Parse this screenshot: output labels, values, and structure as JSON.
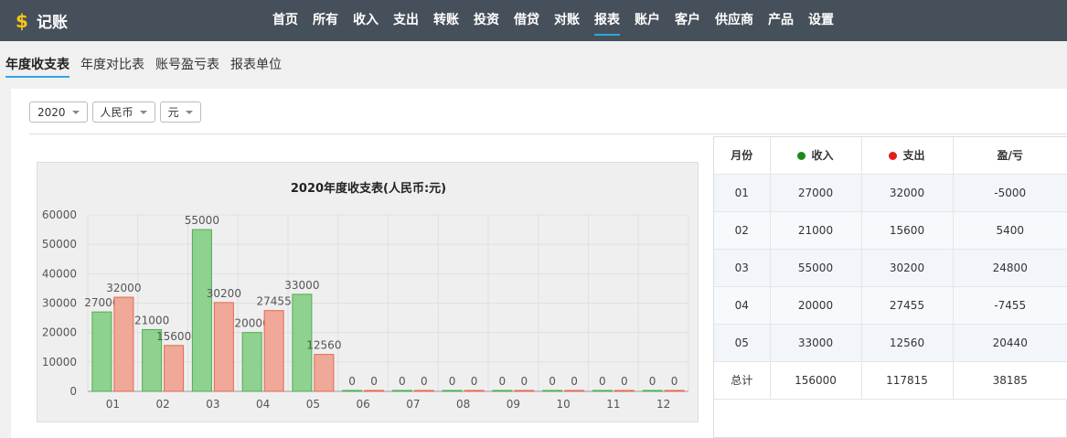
{
  "app": {
    "logo_symbol": "$",
    "title": "记账",
    "accent_color": "#2ea7e0",
    "logo_color": "#f5c518"
  },
  "nav": {
    "items": [
      "首页",
      "所有",
      "收入",
      "支出",
      "转账",
      "投资",
      "借贷",
      "对账",
      "报表",
      "账户",
      "客户",
      "供应商",
      "产品",
      "设置"
    ],
    "active": "报表"
  },
  "subtabs": {
    "items": [
      "年度收支表",
      "年度对比表",
      "账号盈亏表",
      "报表单位"
    ],
    "active": "年度收支表"
  },
  "filters": {
    "year": "2020",
    "currency": "人民币",
    "unit": "元"
  },
  "chart_data": {
    "type": "bar",
    "title": "2020年度收支表(人民币:元)",
    "categories": [
      "01",
      "02",
      "03",
      "04",
      "05",
      "06",
      "07",
      "08",
      "09",
      "10",
      "11",
      "12"
    ],
    "series": [
      {
        "name": "收入",
        "color": "#8fd18f",
        "stroke": "#4caf50",
        "values": [
          27000,
          21000,
          55000,
          20000,
          33000,
          0,
          0,
          0,
          0,
          0,
          0,
          0
        ]
      },
      {
        "name": "支出",
        "color": "#f0a898",
        "stroke": "#e06a50",
        "values": [
          32000,
          15600,
          30200,
          27455,
          12560,
          0,
          0,
          0,
          0,
          0,
          0,
          0
        ]
      }
    ],
    "ylim": [
      0,
      60000
    ],
    "yticks": [
      0,
      10000,
      20000,
      30000,
      40000,
      50000,
      60000
    ],
    "grid": true
  },
  "table": {
    "headers": {
      "month": "月份",
      "income": "收入",
      "expense": "支出",
      "profit": "盈/亏"
    },
    "income_color": "#1a8a1a",
    "expense_color": "#e51c1c",
    "rows": [
      [
        "01",
        "27000",
        "32000",
        "-5000"
      ],
      [
        "02",
        "21000",
        "15600",
        "5400"
      ],
      [
        "03",
        "55000",
        "30200",
        "24800"
      ],
      [
        "04",
        "20000",
        "27455",
        "-7455"
      ],
      [
        "05",
        "33000",
        "12560",
        "20440"
      ]
    ],
    "total": [
      "总计",
      "156000",
      "117815",
      "38185"
    ]
  }
}
